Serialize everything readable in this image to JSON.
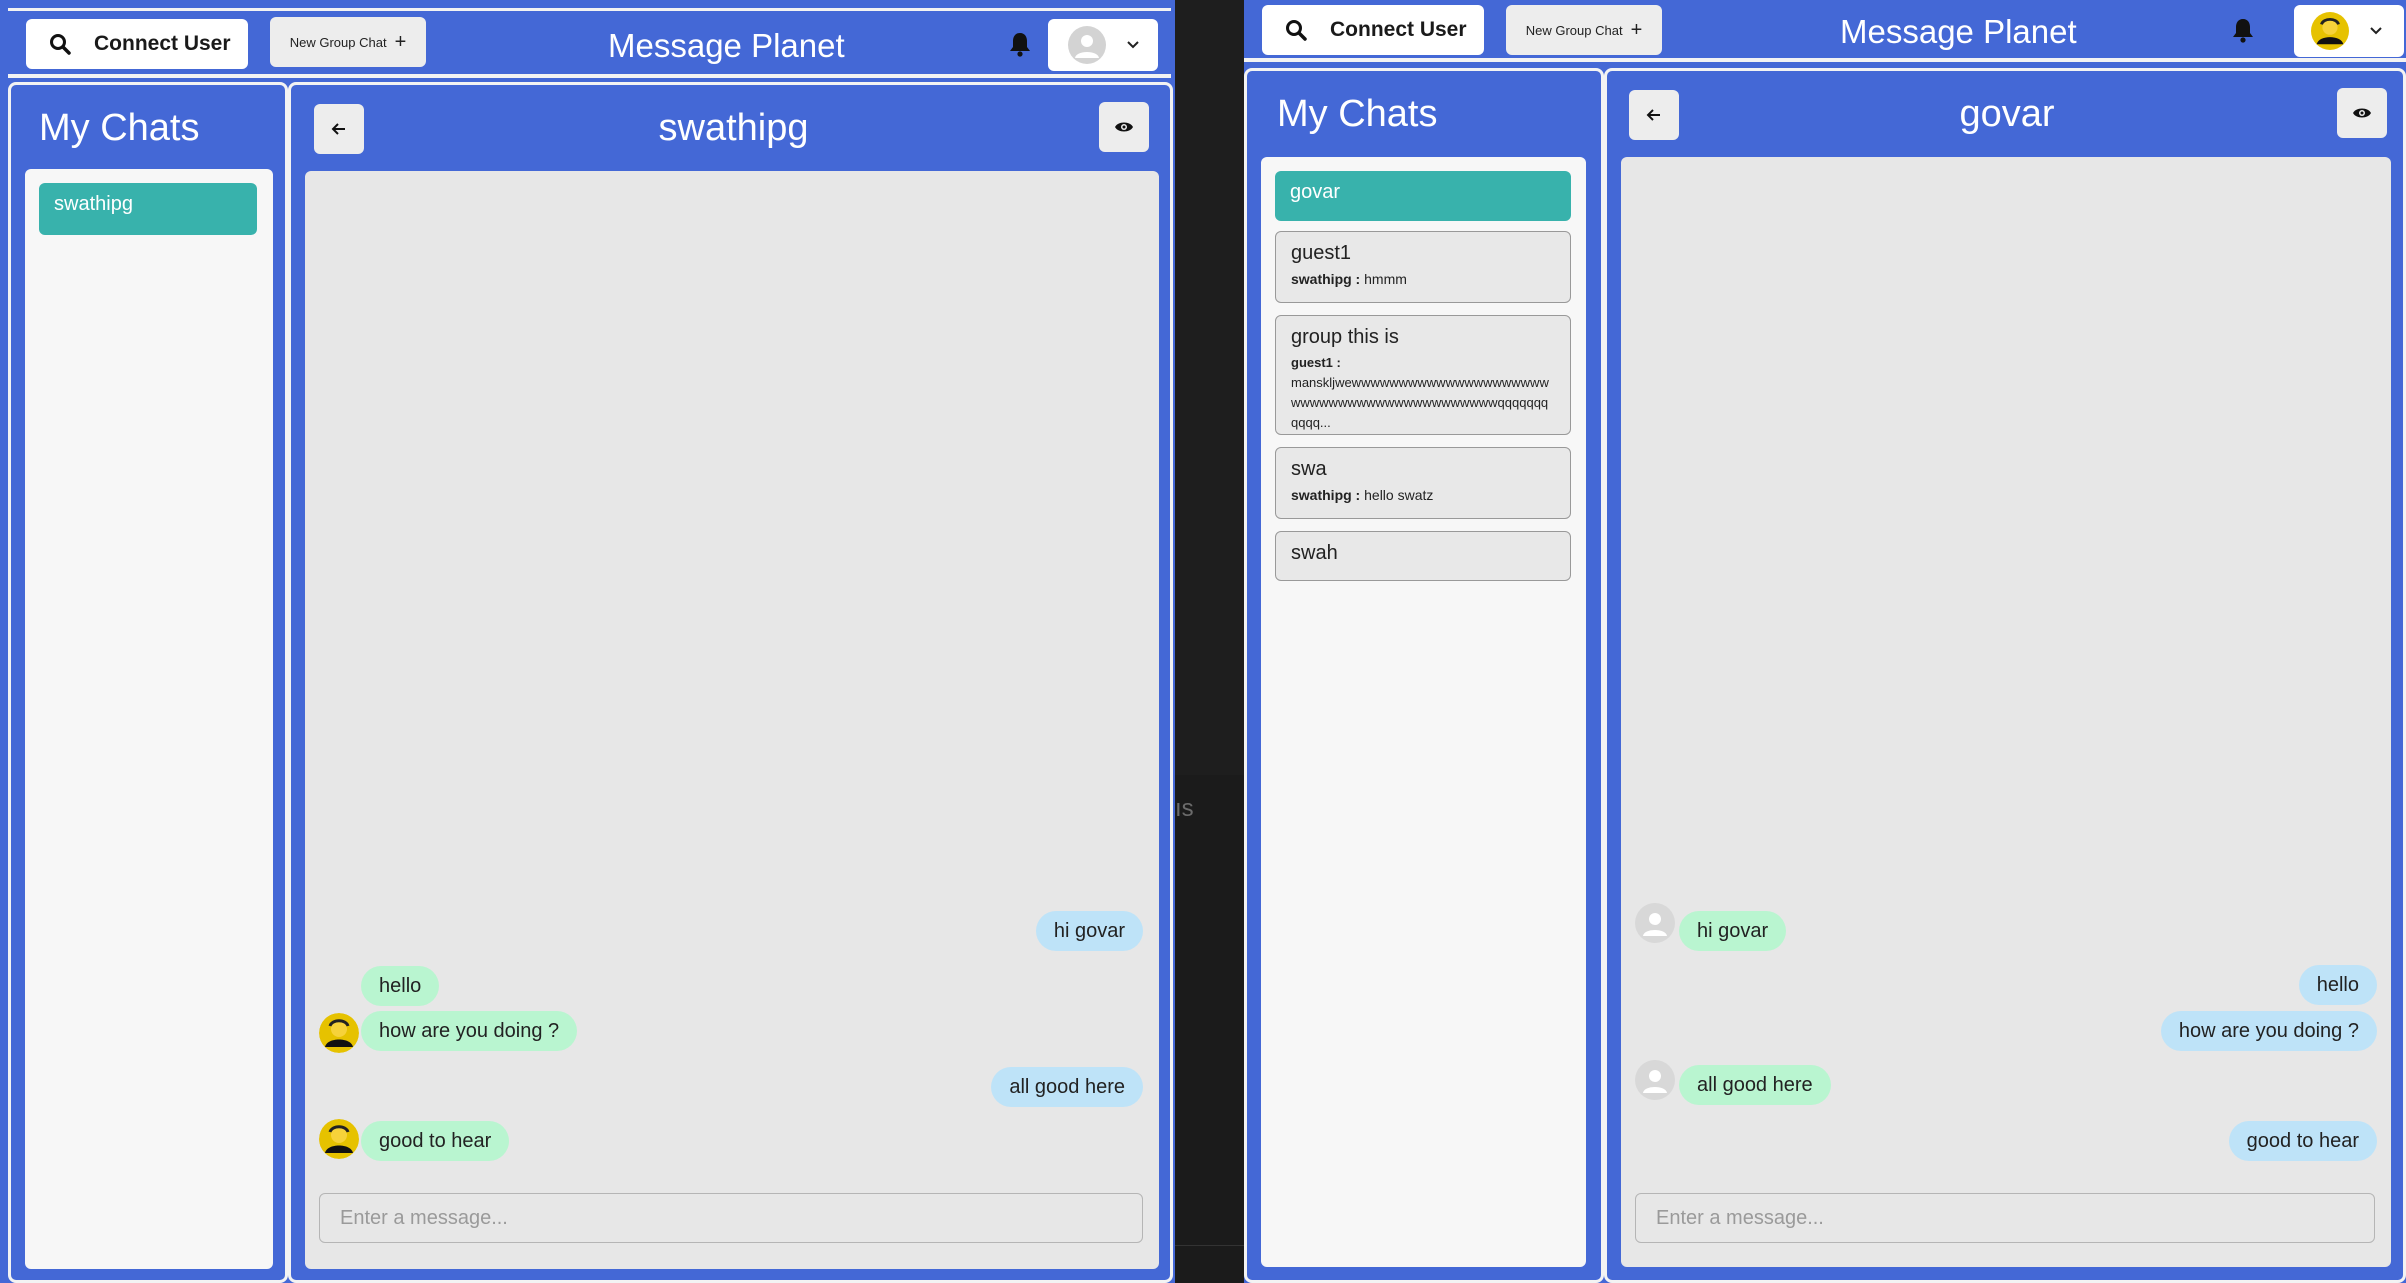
{
  "left": {
    "header": {
      "connect_label": "Connect User",
      "new_group_label": "New Group Chat",
      "app_title": "Message Planet"
    },
    "sidebar": {
      "title": "My Chats",
      "items": [
        {
          "name": "swathipg"
        }
      ]
    },
    "chat": {
      "name": "swathipg",
      "messages": [
        {
          "text": "hi govar",
          "from": "me"
        },
        {
          "text": "hello",
          "from": "them"
        },
        {
          "text": "how are you doing ?",
          "from": "them"
        },
        {
          "text": "all good here",
          "from": "me"
        },
        {
          "text": "good to hear",
          "from": "them"
        }
      ],
      "input_placeholder": "Enter a message..."
    }
  },
  "right": {
    "header": {
      "connect_label": "Connect User",
      "new_group_label": "New Group Chat",
      "app_title": "Message Planet"
    },
    "sidebar": {
      "title": "My Chats",
      "items": [
        {
          "name": "govar"
        },
        {
          "name": "guest1",
          "sender": "swathipg :",
          "last": "hmmm"
        },
        {
          "name": "group this is",
          "sender": "guest1 :",
          "last": "manskljwewwwwwwwwwwwwwwwwwwwwwwwwwwwwwwwwwwwwwwwwwwwqqqqqqqqqqq..."
        },
        {
          "name": "swa",
          "sender": "swathipg :",
          "last": "hello swatz"
        },
        {
          "name": "swah"
        }
      ]
    },
    "chat": {
      "name": "govar",
      "messages": [
        {
          "text": "hi govar",
          "from": "them"
        },
        {
          "text": "hello",
          "from": "me"
        },
        {
          "text": "how are you doing ?",
          "from": "me"
        },
        {
          "text": "all good here",
          "from": "them"
        },
        {
          "text": "good to hear",
          "from": "me"
        }
      ],
      "input_placeholder": "Enter a message..."
    }
  },
  "background": {
    "partial_text": "ıs"
  },
  "colors": {
    "brand_blue": "#4468d6",
    "active_chat": "#38b2ac",
    "bubble_sent": "#bee3f8",
    "bubble_received": "#b9f5d0"
  },
  "icons": [
    "search-icon",
    "plus-icon",
    "bell-icon",
    "chevron-down-icon",
    "arrow-left-icon",
    "eye-icon",
    "user-placeholder-icon"
  ]
}
